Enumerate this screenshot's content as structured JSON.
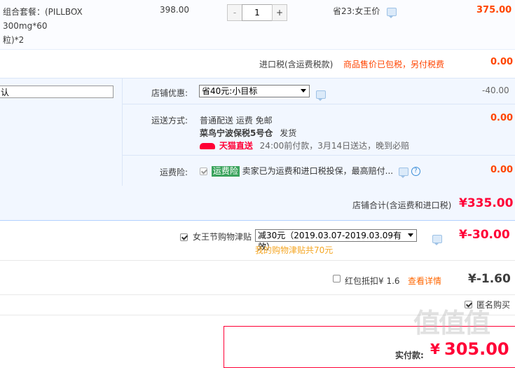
{
  "item": {
    "name": "组合套餐：(PILLBOX 300mg*60粒)*2",
    "name_line1": "组合套餐：(PILLBOX 300mg*60",
    "name_line2": "粒)*2",
    "unit_price": "398.00",
    "quantity": "1",
    "qty_minus": "-",
    "qty_plus": "+",
    "promo": "省23:女王价",
    "subtotal": "375.00"
  },
  "import_tax": {
    "label": "进口税(含运费税款)",
    "note": "商品售价已包税，另付税费",
    "value": "0.00"
  },
  "store_discount": {
    "label": "店铺优惠:",
    "selected": "省40元:小目标",
    "value": "-40.00"
  },
  "message_input": {
    "value": "认"
  },
  "shipping": {
    "label": "运送方式:",
    "method": "普通配送 运费 免邮",
    "warehouse": "菜鸟宁波保税5号仓",
    "ship_word": "发货",
    "badge": "天猫直送",
    "delivery_note": "24:00前付款，3月14日送达，晚到必赔",
    "value": "0.00"
  },
  "insurance": {
    "label": "运费险:",
    "tag": "运费险",
    "text": "卖家已为运费和进口税投保，最高赔付...",
    "value": "0.00"
  },
  "store_total": {
    "label": "店铺合计(含运费和进口税)",
    "value": "¥335.00"
  },
  "allowance": {
    "label": "女王节购物津贴",
    "selected": "减30元（2019.03.07-2019.03.09有效）",
    "note": "我的购物津贴共70元",
    "value": "¥-30.00"
  },
  "red_packet": {
    "label": "红包抵扣¥ 1.6",
    "link": "查看详情",
    "value": "¥-1.60"
  },
  "anonymous": {
    "label": "匿名购买"
  },
  "payment": {
    "label": "实付款:",
    "currency": "¥",
    "value": "305.00"
  },
  "watermark": "值值值",
  "colors": {
    "accent_red": "#ff0036",
    "price_red": "#f40",
    "section_bg": "#f2f7ff",
    "border_blue": "#b2d1ff",
    "link_orange": "#f60"
  }
}
